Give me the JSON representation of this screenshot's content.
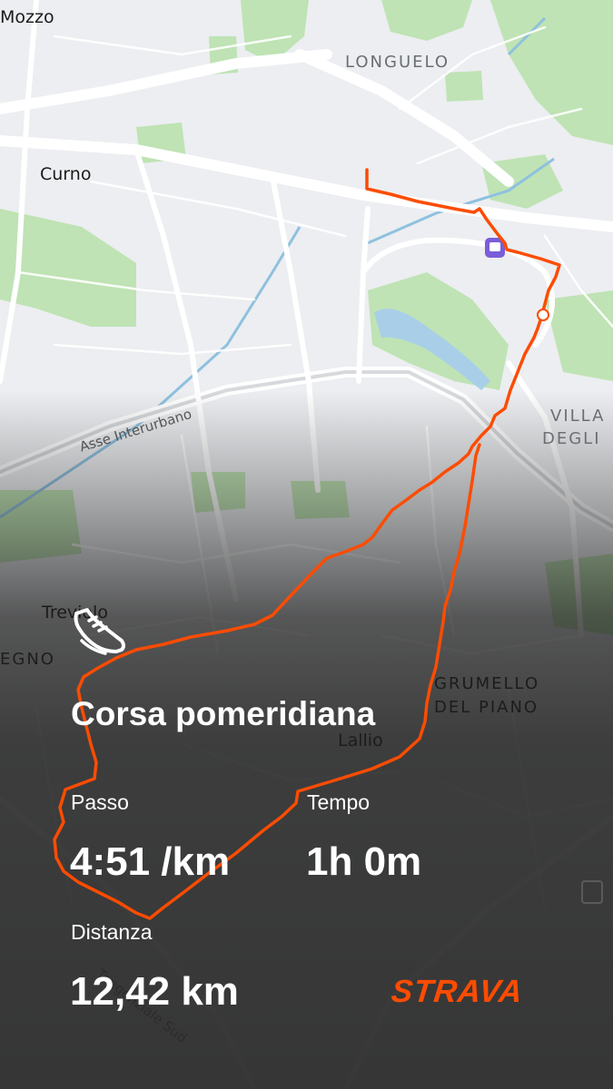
{
  "map": {
    "place_labels": [
      {
        "text": "Mozzo"
      },
      {
        "text": "LONGUELO"
      },
      {
        "text": "Curno"
      },
      {
        "text": "VILLA"
      },
      {
        "text": "DEGLI"
      },
      {
        "text": "Treviolo"
      },
      {
        "text": "EGNO"
      },
      {
        "text": "GRUMELLO"
      },
      {
        "text": "DEL PIANO"
      },
      {
        "text": "Lallio"
      }
    ],
    "road_labels": [
      {
        "text": "Asse Interurbano"
      },
      {
        "text": "Tangenziale Sud"
      }
    ],
    "route_color": "#fc4c02"
  },
  "activity": {
    "icon": "running-shoe-icon",
    "title": "Corsa pomeridiana"
  },
  "stats": {
    "pace_label": "Passo",
    "pace_value": "4:51 /km",
    "time_label": "Tempo",
    "time_value": "1h 0m",
    "distance_label": "Distanza",
    "distance_value": "12,42 km"
  },
  "brand": {
    "name": "STRAVA",
    "color": "#fc4c02"
  }
}
